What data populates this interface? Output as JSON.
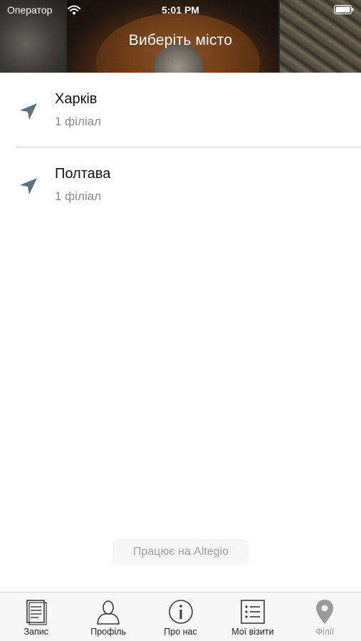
{
  "status_bar": {
    "carrier": "Оператор",
    "time": "5:01 PM",
    "wifi_icon": "wifi-icon",
    "battery_icon": "battery-icon"
  },
  "header": {
    "title": "Виберіть місто"
  },
  "cities": [
    {
      "name": "Харків",
      "subtitle": "1 філіал",
      "icon": "location-arrow-icon"
    },
    {
      "name": "Полтава",
      "subtitle": "1 філіал",
      "icon": "location-arrow-icon"
    }
  ],
  "powered_by": "Працює на Altegio",
  "tabbar": {
    "tabs": [
      {
        "label": "Запис",
        "icon": "document-icon",
        "active": false
      },
      {
        "label": "Профіль",
        "icon": "person-icon",
        "active": false
      },
      {
        "label": "Про нас",
        "icon": "info-icon",
        "active": false
      },
      {
        "label": "Мої візити",
        "icon": "list-icon",
        "active": false
      },
      {
        "label": "Філії",
        "icon": "map-pin-icon",
        "active": true
      }
    ]
  },
  "colors": {
    "icon_slate": "#5c7280",
    "tab_icon": "#3a3a3a",
    "tab_icon_active": "#9a9a9a",
    "subtitle_gray": "#8a8a8a"
  }
}
